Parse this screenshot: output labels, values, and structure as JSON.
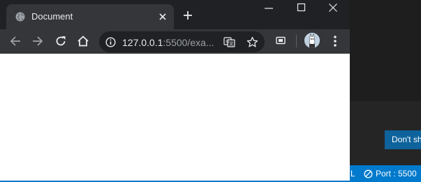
{
  "browser": {
    "tab": {
      "title": "Document",
      "favicon": "globe-icon"
    },
    "window_controls": [
      "minimize-icon",
      "maximize-icon",
      "close-icon"
    ],
    "toolbar": {
      "back": "back-arrow-icon",
      "forward": "forward-arrow-icon",
      "reload": "reload-icon",
      "home": "home-icon",
      "address_host": "127.0.0.1",
      "address_rest": ":5500/exa...",
      "site_info": "info-icon",
      "translate": "translate-icon",
      "bookmark": "star-icon",
      "extension": "extension-icon",
      "menu": "kebab-menu-icon"
    }
  },
  "vscode": {
    "notification_button": "Don't sh",
    "status_fragment": "L",
    "status_port": "Port : 5500"
  },
  "colors": {
    "chrome_titlebar": "#202124",
    "chrome_toolbar": "#35363a",
    "vscode_status": "#007acc",
    "vscode_button": "#0e639c"
  }
}
